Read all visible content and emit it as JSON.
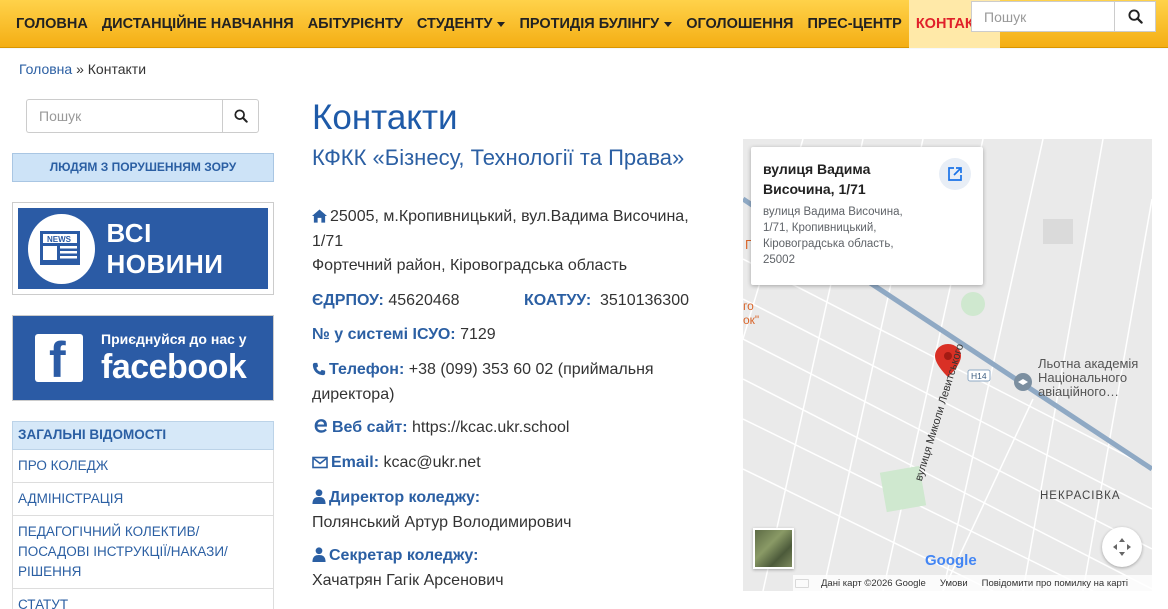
{
  "nav": {
    "items": [
      {
        "label": "Головна"
      },
      {
        "label": "Дистанційне навчання"
      },
      {
        "label": "Абітурієнту"
      },
      {
        "label": "Студенту"
      },
      {
        "label": "Протидія булінгу"
      },
      {
        "label": "Оголошення"
      },
      {
        "label": "Прес-центр"
      },
      {
        "label": "Контакти"
      }
    ],
    "search_placeholder": "Пошук"
  },
  "breadcrumb": {
    "home": "Головна",
    "separator": "»",
    "current": "Контакти"
  },
  "sidebar": {
    "search_placeholder": "Пошук",
    "vision_label": "Людям з порушенням зору",
    "news_banner": {
      "badge": "NEWS",
      "text": "ВСІ НОВИНИ"
    },
    "fb_banner": {
      "small": "Приєднуйся до нас у",
      "big": "facebook"
    },
    "menu_title": "Загальні відомості",
    "menu": [
      {
        "label": "Про коледж"
      },
      {
        "label": "Адміністрація"
      },
      {
        "label": "Педагогічний колектив/ посадові інструкції/накази/ рішення"
      },
      {
        "label": "Статут"
      }
    ]
  },
  "content": {
    "title": "Контакти",
    "subtitle": "КФКК «Бізнесу, Технології та Права»",
    "address_line1": "25005, м.Кропивницький, вул.Вадима Височина, 1/71",
    "address_line2": "Фортечний район, Кіровоградська область",
    "edrpou_label": "ЄДРПОУ:",
    "edrpou_value": "45620468",
    "koatuu_label": "КОАТУУ:",
    "koatuu_value": "3510136300",
    "isuo_label": "№ у системі ІСУО:",
    "isuo_value": "7129",
    "phone_label": "Телефон:",
    "phone_value": "+38 (099) 353 60 02 (приймальня директора)",
    "web_label": "Веб сайт:",
    "web_value": "https://kcac.ukr.school",
    "email_label": "Email:",
    "email_value": "kcac@ukr.net",
    "director_label": "Директор коледжу:",
    "director_value": "Полянський Артур Володимирович",
    "secretary_label": "Секретар коледжу:",
    "secretary_value": "Хачатрян Гагік Арсенович"
  },
  "map": {
    "card_title": "вулиця Вадима Височина, 1/71",
    "card_address": "вулиця Вадима Височина, 1/71, Кропивницький, Кіровоградська область, 25002",
    "poi_name": "Льотна академія Національного авіаційного…",
    "street_name": "вулиця Миколи Левитського",
    "district": "НЕКРАСІВКА",
    "road_label": "H14",
    "partial_label_1": "Г",
    "partial_label_2": "го",
    "partial_label_3": "ок\"",
    "attribution": "Дані карт ©2026 Google",
    "terms": "Умови",
    "report": "Повідомити про помилку на карті",
    "google": "Google"
  },
  "colors": {
    "accent": "#2b5fa3",
    "nav_bg": "#f9c12e",
    "active": "#e0202a",
    "pin": "#d93025"
  }
}
